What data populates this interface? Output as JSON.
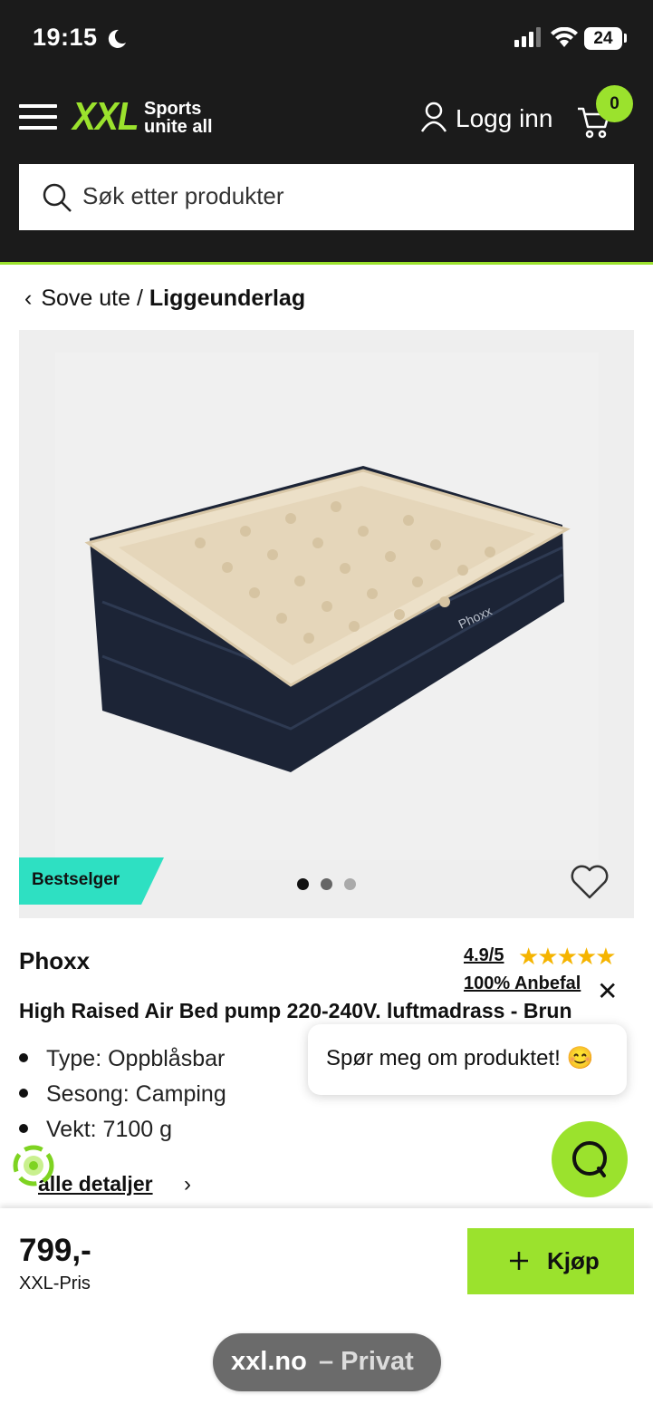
{
  "status_bar": {
    "time": "19:15",
    "battery": "24"
  },
  "header": {
    "logo": "XXL",
    "tagline_1": "Sports",
    "tagline_2": "unite all",
    "login_label": "Logg inn",
    "cart_count": "0"
  },
  "search": {
    "placeholder": "Søk etter produkter"
  },
  "breadcrumb": {
    "parent": "Sove ute",
    "separator": "/",
    "current": "Liggeunderlag"
  },
  "gallery": {
    "badge": "Bestselger",
    "active_dot": 0,
    "dot_count": 3,
    "image_brand_text": "Phoxx"
  },
  "product": {
    "brand": "Phoxx",
    "rating": "4.9/5",
    "rating_stars": 5,
    "recommend": "100% Anbefal",
    "title": "High Raised Air Bed pump 220-240V. luftmadrass - Brun",
    "specs": [
      "Type: Oppblåsbar",
      "Sesong: Camping",
      "Vekt: 7100 g"
    ],
    "details_link": "alle detaljer"
  },
  "chat": {
    "prompt": "Spør meg om produktet! 😊"
  },
  "purchase": {
    "price": "799,-",
    "price_label": "XXL-Pris",
    "buy_label": "Kjøp"
  },
  "browser": {
    "host": "xxl.no",
    "mode": "– Privat"
  },
  "colors": {
    "brand_green": "#9be22d",
    "header_bg": "#1b1b1b",
    "teal_badge": "#2ee0c2",
    "star": "#f5b400"
  }
}
